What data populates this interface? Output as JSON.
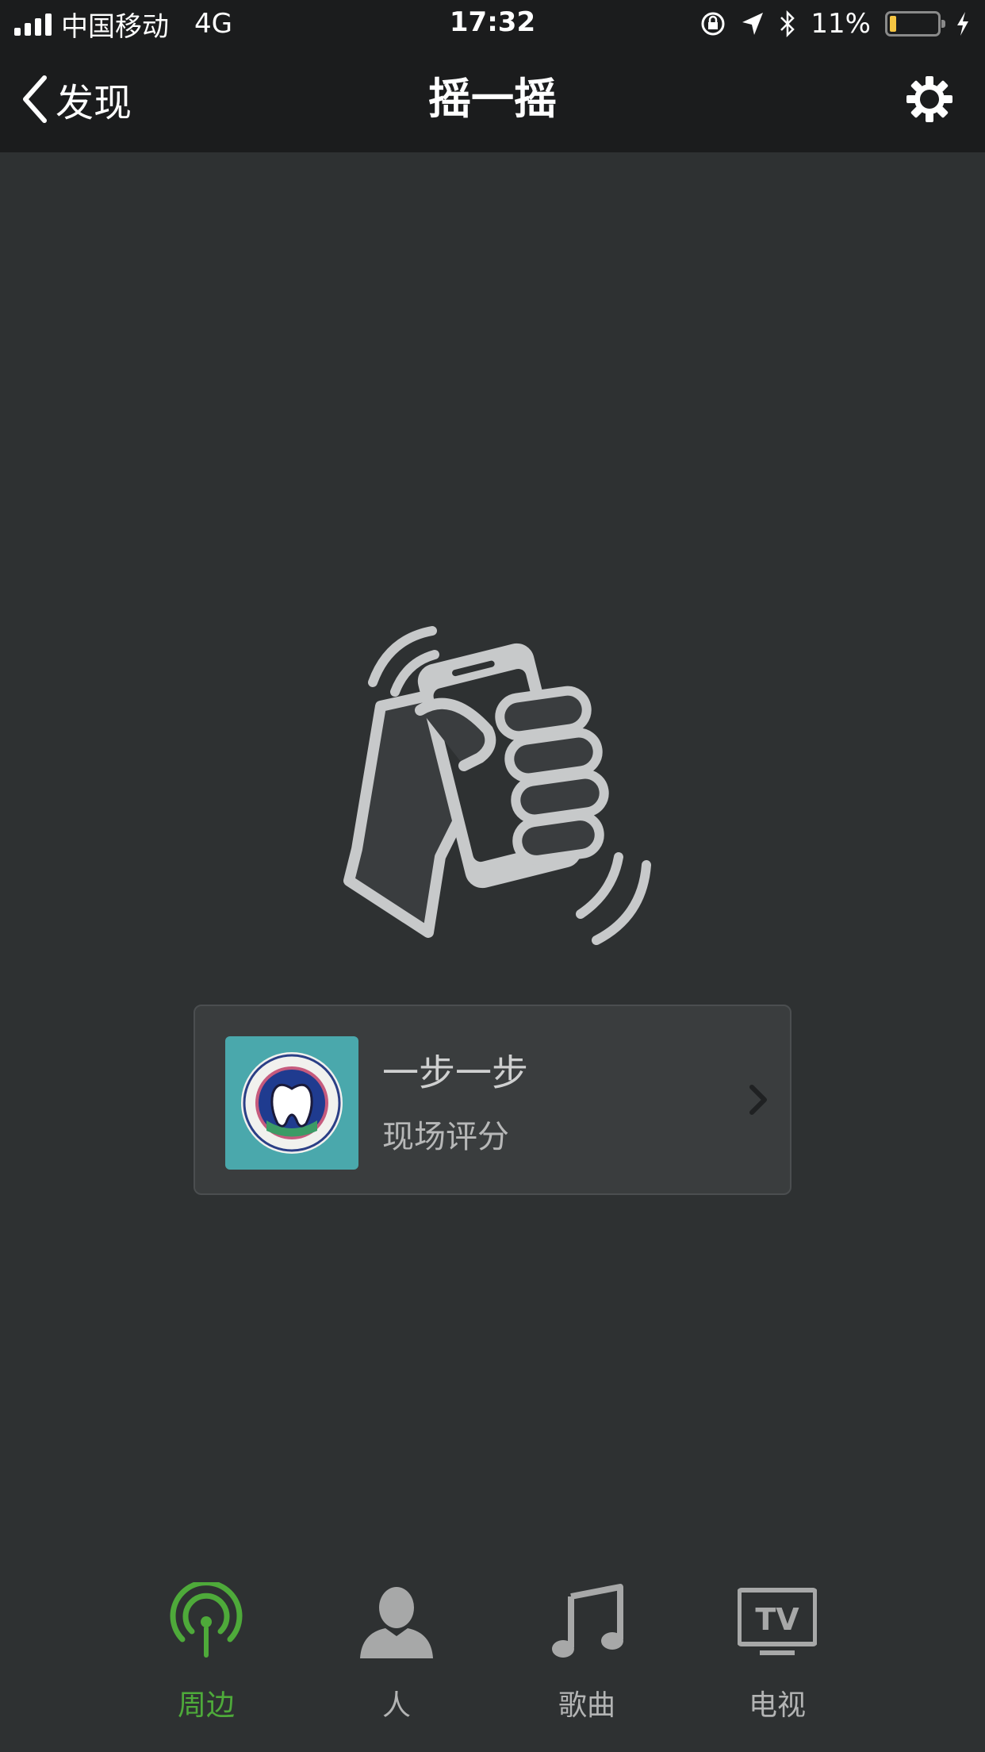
{
  "status_bar": {
    "carrier": "中国移动",
    "network": "4G",
    "time": "17:32",
    "battery_percent": "11%",
    "battery_level": 0.11
  },
  "nav": {
    "back_label": "发现",
    "title": "摇一摇",
    "settings_icon": "gear-icon"
  },
  "result_card": {
    "title": "一步一步",
    "subtitle": "现场评分",
    "thumbnail_icon": "tooth-logo-icon",
    "thumbnail_bg": "#4aa8ac"
  },
  "tabs": [
    {
      "label": "周边",
      "icon": "nearby-icon",
      "active": true
    },
    {
      "label": "人",
      "icon": "person-icon",
      "active": false
    },
    {
      "label": "歌曲",
      "icon": "music-note-icon",
      "active": false
    },
    {
      "label": "电视",
      "icon": "tv-icon",
      "active": false
    }
  ],
  "colors": {
    "background": "#2e3132",
    "bar": "#1b1c1d",
    "active_tab": "#4eaa3a",
    "inactive_tab": "#b3b4b4"
  }
}
